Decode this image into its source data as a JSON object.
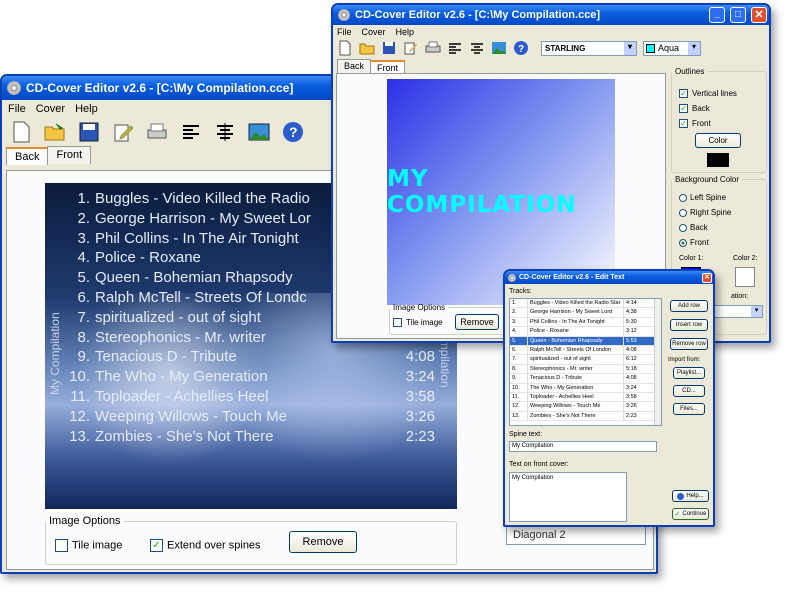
{
  "back_window": {
    "title": "CD-Cover Editor v2.6 - [C:\\My Compilation.cce]",
    "menu": [
      "File",
      "Cover",
      "Help"
    ],
    "tabs": [
      "Back",
      "Front"
    ],
    "spine_left": "My Compilation",
    "spine_right": "My Compilation",
    "tracks": [
      {
        "num": "1.",
        "title": "Buggles - Video Killed the Radio",
        "time": ""
      },
      {
        "num": "2.",
        "title": "George Harrison - My Sweet Lor",
        "time": ""
      },
      {
        "num": "3.",
        "title": "Phil Collins - In The Air Tonight",
        "time": ""
      },
      {
        "num": "4.",
        "title": "Police - Roxane",
        "time": ""
      },
      {
        "num": "5.",
        "title": "Queen - Bohemian Rhapsody",
        "time": ""
      },
      {
        "num": "6.",
        "title": "Ralph McTell - Streets Of Londc",
        "time": ""
      },
      {
        "num": "7.",
        "title": "spiritualized - out of sight",
        "time": ""
      },
      {
        "num": "8.",
        "title": "Stereophonics - Mr. writer",
        "time": ""
      },
      {
        "num": "9.",
        "title": "Tenacious D - Tribute",
        "time": "4:08"
      },
      {
        "num": "10.",
        "title": "The Who - My Generation",
        "time": "3:24"
      },
      {
        "num": "11.",
        "title": "Toploader - Achellies Heel",
        "time": "3:58"
      },
      {
        "num": "12.",
        "title": "Weeping Willows - Touch Me",
        "time": "3:26"
      },
      {
        "num": "13.",
        "title": "Zombies - She's Not There",
        "time": "2:23"
      }
    ],
    "image_options": {
      "legend": "Image Options",
      "tile": "Tile image",
      "extend": "Extend over spines",
      "remove": "Remove"
    }
  },
  "front_window": {
    "title": "CD-Cover Editor v2.6 - [C:\\My Compilation.cce]",
    "menu": [
      "File",
      "Cover",
      "Help"
    ],
    "font_name": "STARLING",
    "color_name": "Aqua",
    "tabs": [
      "Back",
      "Front"
    ],
    "cover_text": "MY COMPILATION",
    "image_options": {
      "legend": "Image Options",
      "tile": "Tile image",
      "remove": "Remove"
    },
    "outlines": {
      "legend": "Outlines",
      "vertical": "Vertical lines",
      "back": "Back",
      "front": "Front",
      "color_btn": "Color"
    },
    "background": {
      "legend": "Background Color",
      "left_spine": "Left Spine",
      "right_spine": "Right Spine",
      "back": "Back",
      "front": "Front",
      "color1": "Color 1:",
      "color2": "Color 2:",
      "direction": "ation:"
    },
    "partial_text": "Diagonal 2"
  },
  "edit_dialog": {
    "title": "CD-Cover Editor v2.6 - Edit Text",
    "tracks_label": "Tracks:",
    "rows": [
      {
        "num": "1.",
        "title": "Buggles - Video Killed the Radio Star",
        "time": "4:14"
      },
      {
        "num": "2.",
        "title": "George Harrison - My Sweet Lord",
        "time": "4:38"
      },
      {
        "num": "3.",
        "title": "Phil Collins - In The Air Tonight",
        "time": "5:30"
      },
      {
        "num": "4.",
        "title": "Police - Roxane",
        "time": "3:12"
      },
      {
        "num": "5.",
        "title": "Queen - Bohemian Rhapsody",
        "time": "5:53"
      },
      {
        "num": "6.",
        "title": "Ralph McTell - Streets Of London",
        "time": "4:08"
      },
      {
        "num": "7.",
        "title": "spiritualized - out of sight",
        "time": "6:12"
      },
      {
        "num": "8.",
        "title": "Stereophonics - Mr. writer",
        "time": "5:18"
      },
      {
        "num": "9.",
        "title": "Tenacious D - Tribute",
        "time": "4:08"
      },
      {
        "num": "10.",
        "title": "The Who - My Generation",
        "time": "3:24"
      },
      {
        "num": "11.",
        "title": "Toploader - Achellies Heel",
        "time": "3:58"
      },
      {
        "num": "12.",
        "title": "Weeping Willows - Touch Me",
        "time": "3:26"
      },
      {
        "num": "13.",
        "title": "Zombies - She's Not There",
        "time": "2:23"
      }
    ],
    "buttons": {
      "add": "Add row",
      "insert": "Insert row",
      "remove": "Remove row",
      "import_label": "Import from:",
      "playlist": "Playlist...",
      "cd": "CD...",
      "files": "Files...",
      "help": "Help...",
      "continue": "Continue"
    },
    "spine_label": "Spine text:",
    "spine_value": "My Compilation",
    "front_label": "Text on front cover:",
    "front_value": "My Compilation"
  }
}
